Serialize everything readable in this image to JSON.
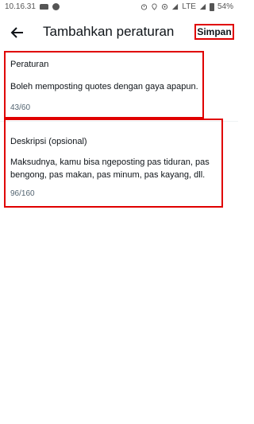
{
  "status_bar": {
    "time": "10.16.31",
    "network": "LTE",
    "battery": "54%"
  },
  "app_bar": {
    "title": "Tambahkan peraturan",
    "save_label": "Simpan"
  },
  "form": {
    "rule": {
      "label": "Peraturan",
      "value": "Boleh memposting quotes dengan gaya apapun.",
      "counter": "43/60"
    },
    "description": {
      "label": "Deskripsi (opsional)",
      "value": "Maksudnya, kamu bisa ngeposting pas tiduran, pas bengong, pas makan, pas minum, pas kayang, dll.",
      "counter": "96/160"
    }
  },
  "colors": {
    "highlight": "#e00000",
    "text": "#0f1419",
    "muted": "#536471"
  }
}
